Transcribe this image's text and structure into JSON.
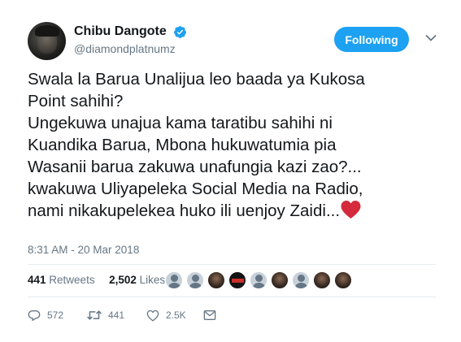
{
  "user": {
    "display_name": "Chibu Dangote",
    "handle": "@diamondplatnumz"
  },
  "follow_button": {
    "label": "Following"
  },
  "tweet": {
    "lines": [
      "Swala la Barua Unalijua leo baada ya Kukosa",
      "Point sahihi?",
      "Ungekuwa unajua kama taratibu sahihi ni",
      "Kuandika Barua, Mbona hukuwatumia pia",
      "Wasanii barua zakuwa unafungia kazi zao?...",
      "kwakuwa Uliyapeleka Social Media na Radio,",
      "nami nikakupelekea huko ili uenjoy Zaidi..."
    ],
    "emoji": "red-heart"
  },
  "timestamp": "8:31 AM - 20 Mar 2018",
  "stats": {
    "retweets_count": "441",
    "retweets_label": "Retweets",
    "likes_count": "2,502",
    "likes_label": "Likes"
  },
  "actions": {
    "replies": "572",
    "retweets": "441",
    "likes": "2.5K"
  },
  "colors": {
    "accent": "#1da1f2",
    "text": "#14171a",
    "muted": "#657786",
    "heart": "#d42a3c",
    "retweet_icon": "#17bf63"
  },
  "icons": [
    "verified-icon",
    "chevron-down-icon",
    "reply-icon",
    "retweet-icon",
    "like-icon",
    "message-icon"
  ]
}
